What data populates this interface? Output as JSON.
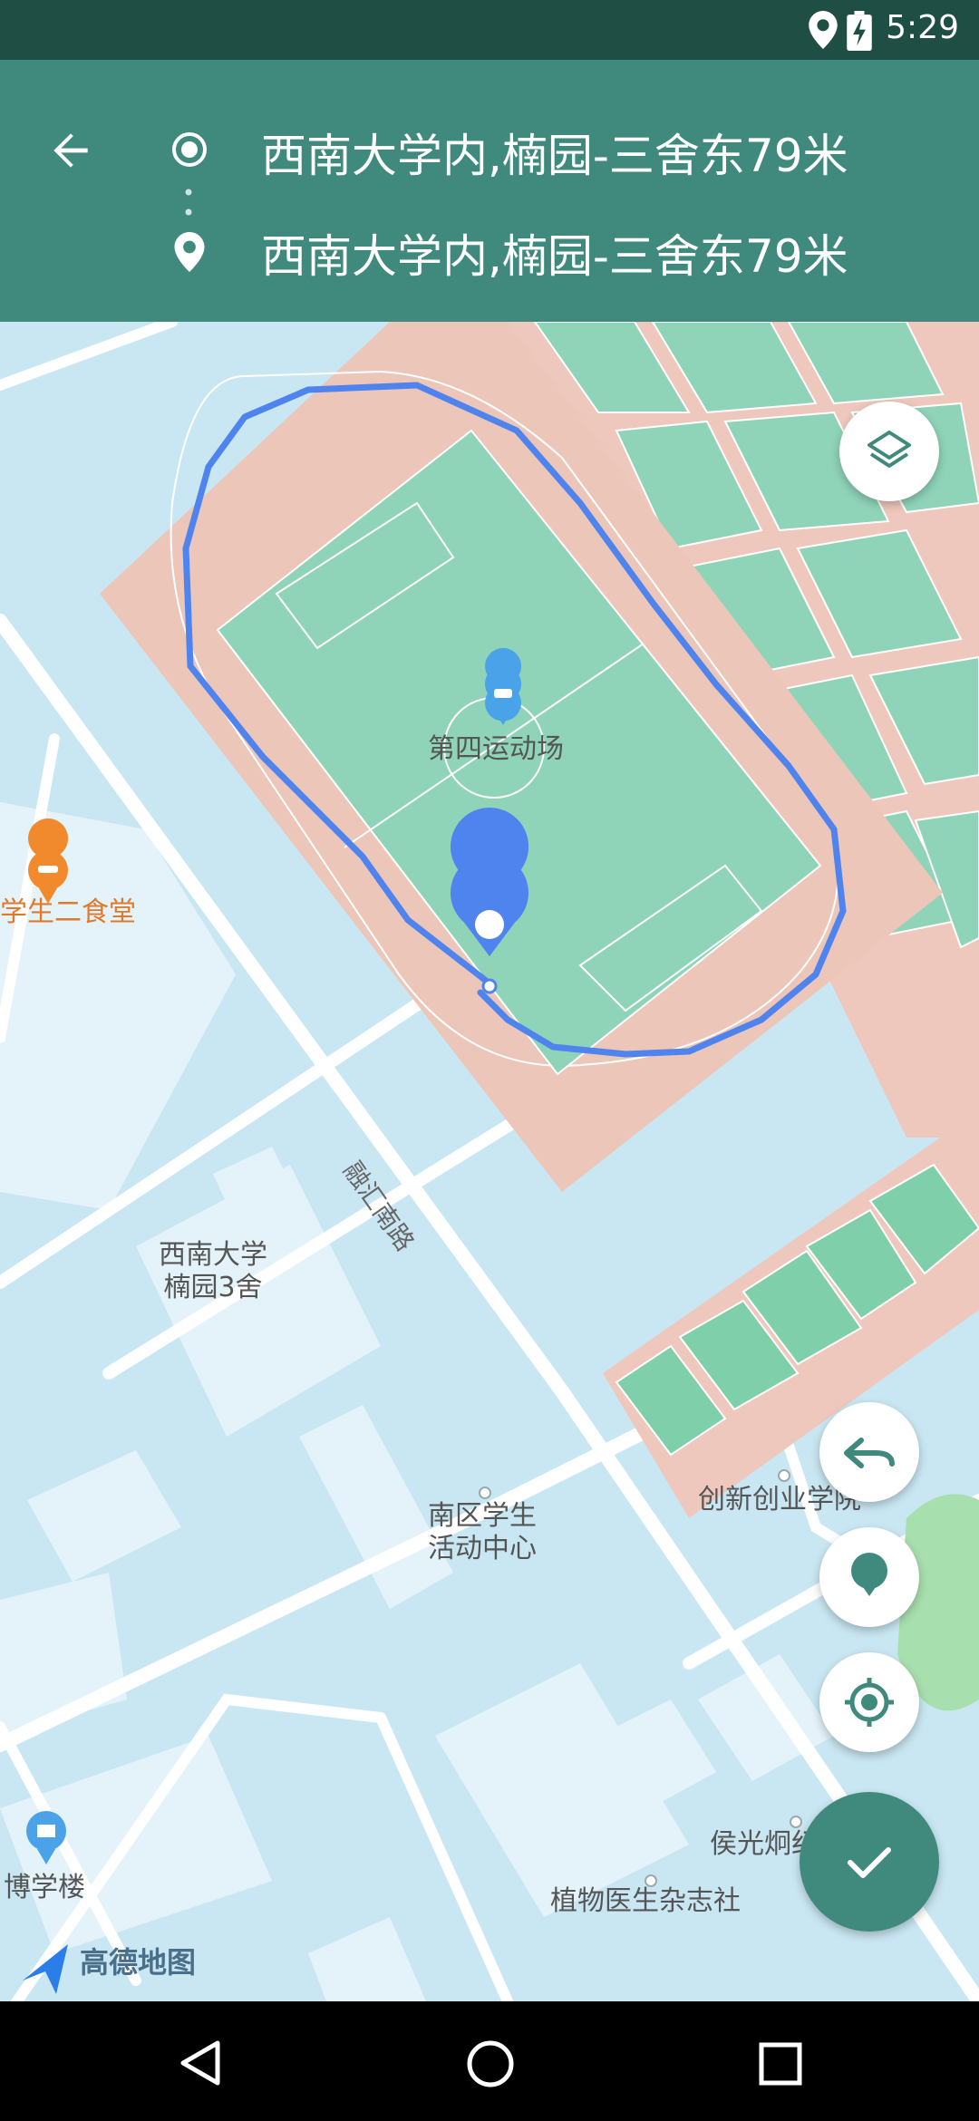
{
  "status_bar": {
    "time": "5:29",
    "icons": [
      "location-icon",
      "battery-charging-icon"
    ]
  },
  "route": {
    "start_address": "西南大学内,楠园-三舍东79米",
    "end_address": "西南大学内,楠园-三舍东79米"
  },
  "map": {
    "labels": {
      "stadium": "第四运动场",
      "canteen": "学生二食堂",
      "dorm": "西南大学\n楠园3舍",
      "road": "融汇南路",
      "activity_center": "南区学生\n活动中心",
      "innovation": "创新创业学院",
      "library": "博学楼",
      "plant_doctor": "植物医生杂志社",
      "hou_guang": "侯光炯纪"
    },
    "brand": "高德地图"
  },
  "colors": {
    "status_bar": "#1f4e44",
    "toolbar": "#3f8a7d",
    "route_line": "#4f83ee",
    "confirm_fab": "#3f8a7d"
  }
}
